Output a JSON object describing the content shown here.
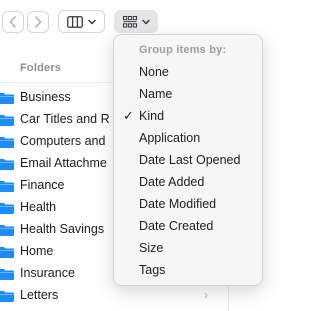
{
  "toolbar": {
    "back_icon": "chevron-left-icon",
    "forward_icon": "chevron-right-icon",
    "view_icon": "columns-view-icon",
    "group_icon": "grid-group-icon"
  },
  "sidebar": {
    "section_header": "Folders",
    "folders": [
      {
        "label": "Business"
      },
      {
        "label": "Car Titles and R"
      },
      {
        "label": "Computers and"
      },
      {
        "label": "Email Attachme"
      },
      {
        "label": "Finance"
      },
      {
        "label": "Health"
      },
      {
        "label": "Health Savings"
      },
      {
        "label": "Home"
      },
      {
        "label": "Insurance"
      },
      {
        "label": "Letters"
      }
    ],
    "folder_color": "#1f8cf5"
  },
  "group_menu": {
    "header": "Group items by:",
    "items": [
      {
        "label": "None",
        "checked": false
      },
      {
        "label": "Name",
        "checked": false
      },
      {
        "label": "Kind",
        "checked": true
      },
      {
        "label": "Application",
        "checked": false
      },
      {
        "label": "Date Last Opened",
        "checked": false
      },
      {
        "label": "Date Added",
        "checked": false
      },
      {
        "label": "Date Modified",
        "checked": false
      },
      {
        "label": "Date Created",
        "checked": false
      },
      {
        "label": "Size",
        "checked": false
      },
      {
        "label": "Tags",
        "checked": false
      }
    ]
  }
}
